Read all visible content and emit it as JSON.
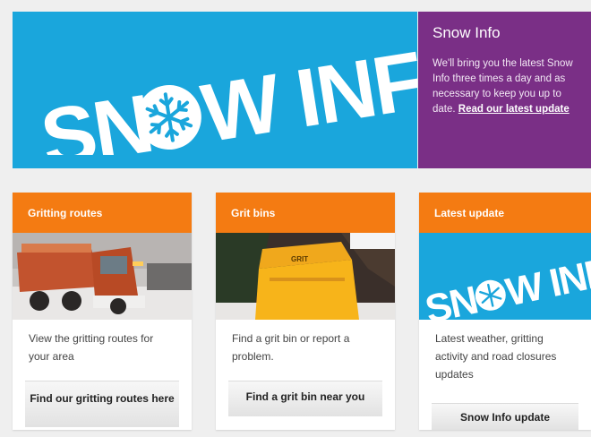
{
  "hero": {
    "logo_text": "SNOW INFO"
  },
  "info_panel": {
    "title": "Snow Info",
    "body": "We'll bring you the latest Snow Info three times a day and as necessary to keep you up to date.",
    "link": "Read our latest update"
  },
  "cards": [
    {
      "title": "Gritting routes",
      "image": "gritter-lorry-photo",
      "text": "View the gritting routes for your area",
      "button": "Find our gritting routes here"
    },
    {
      "title": "Grit bins",
      "image": "yellow-grit-bin-photo",
      "text": "Find a grit bin or report a problem.",
      "button": "Find a grit bin near you"
    },
    {
      "title": "Latest update",
      "image": "snow-info-logo",
      "text": "Latest weather, gritting activity and road closures updates",
      "button": "Snow Info update"
    }
  ],
  "colors": {
    "hero_blue": "#1aa6dc",
    "panel_purple": "#7a2f86",
    "card_orange": "#f47b12"
  }
}
